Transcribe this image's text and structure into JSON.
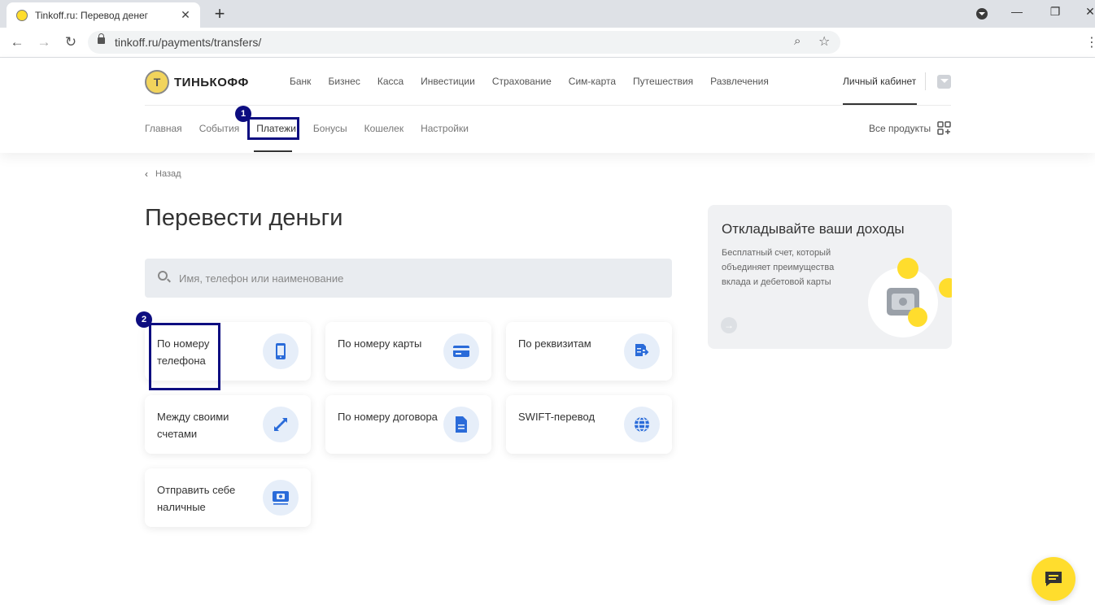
{
  "browser": {
    "tab_title": "Tinkoff.ru: Перевод денег",
    "tab_close": "✕",
    "new_tab": "+",
    "url": "tinkoff.ru/payments/transfers/",
    "window_controls": {
      "minimize": "—",
      "restore": "❐",
      "close": "✕"
    }
  },
  "header": {
    "logo_text": "ТИНЬКОФФ",
    "logo_emblem": "Т",
    "topnav": [
      "Банк",
      "Бизнес",
      "Касса",
      "Инвестиции",
      "Страхование",
      "Сим-карта",
      "Путешествия",
      "Развлечения"
    ],
    "cabinet": "Личный кабинет",
    "subnav": [
      "Главная",
      "События",
      "Платежи",
      "Бонусы",
      "Кошелек",
      "Настройки"
    ],
    "subnav_active": "Платежи",
    "all_products": "Все продукты"
  },
  "annotations": {
    "badge1": "1",
    "badge2": "2"
  },
  "main": {
    "back": "Назад",
    "title": "Перевести деньги",
    "search_placeholder": "Имя, телефон или наименование",
    "cards": [
      {
        "label": "По номеру телефона",
        "icon": "phone-icon"
      },
      {
        "label": "По номеру карты",
        "icon": "card-icon"
      },
      {
        "label": "По реквизитам",
        "icon": "requisites-icon"
      },
      {
        "label": "Между своими счетами",
        "icon": "exchange-arrows-icon"
      },
      {
        "label": "По номеру договора",
        "icon": "document-icon"
      },
      {
        "label": "SWIFT-перевод",
        "icon": "globe-icon"
      },
      {
        "label": "Отправить себе наличные",
        "icon": "cash-icon"
      }
    ]
  },
  "promo": {
    "title": "Откладывайте ваши доходы",
    "text": "Бесплатный счет, который объединяет преимущества вклада и дебетовой карты",
    "arrow": "→"
  },
  "colors": {
    "accent": "#ffdd2d",
    "icon_blue": "#2a6bd9",
    "annotation": "#0d0d80"
  }
}
